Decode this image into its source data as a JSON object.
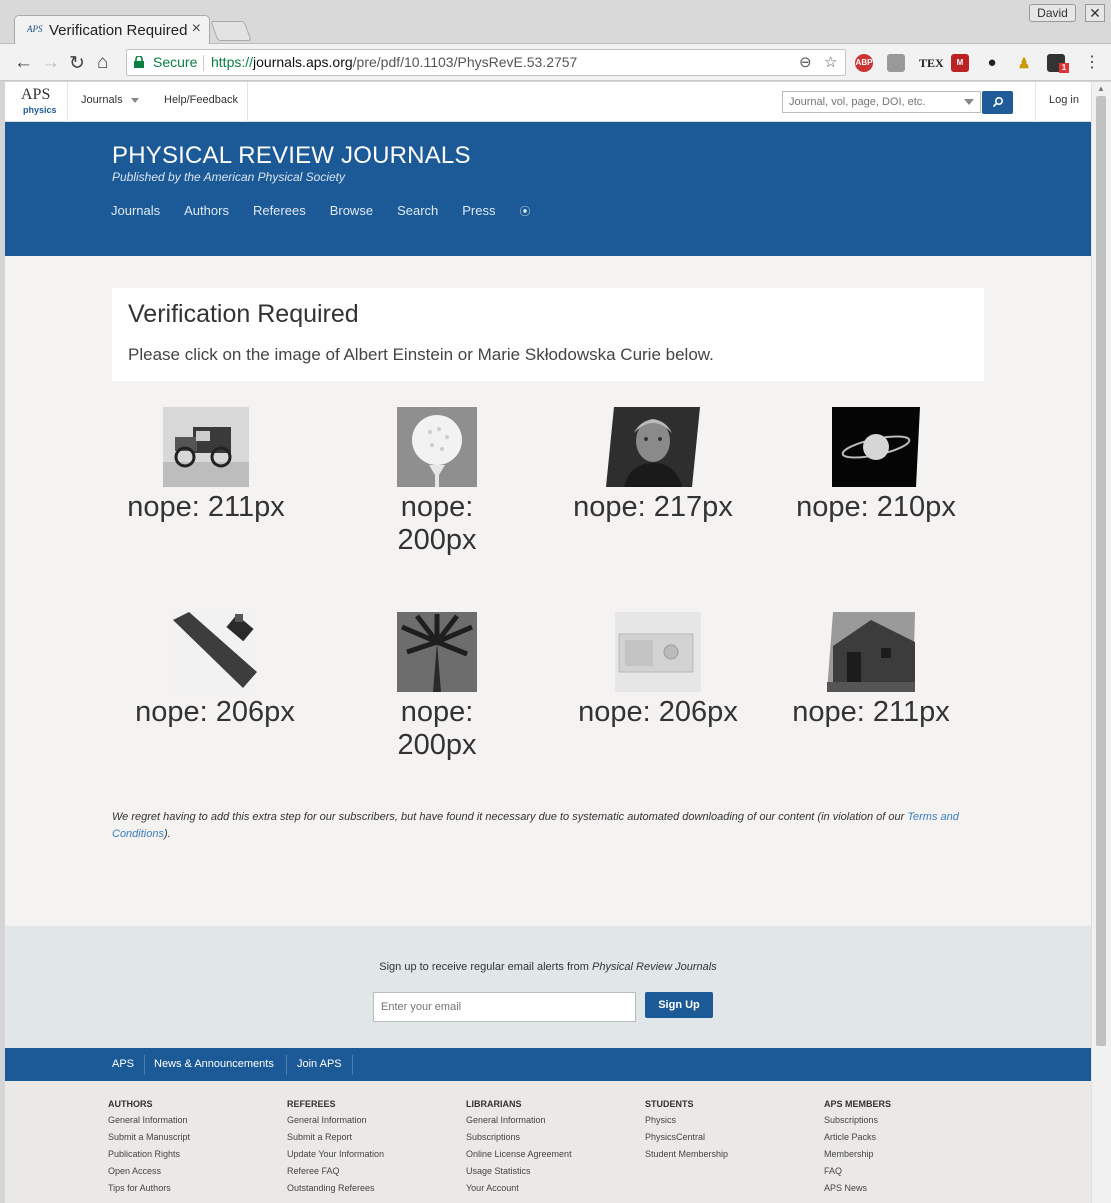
{
  "browser": {
    "tab_title": "Verification Required",
    "tab_favicon": "APS",
    "profile": "David",
    "close": "✕",
    "secure": "Secure",
    "url_scheme": "https://",
    "url_host": "journals.aps.org",
    "url_path": "/pre/pdf/10.1103/PhysRevE.53.2757",
    "ext_abp": "ABP",
    "ext_badge": "1"
  },
  "aps": {
    "logo_text": "APS",
    "logo_sub": "physics",
    "journals": "Journals",
    "help": "Help/Feedback",
    "search_placeholder": "Journal, vol, page, DOI, etc.",
    "login": "Log in"
  },
  "hero": {
    "title": "PHYSICAL REVIEW JOURNALS",
    "subtitle": "Published by the American Physical Society",
    "nav": [
      "Journals",
      "Authors",
      "Referees",
      "Browse",
      "Search",
      "Press"
    ]
  },
  "verify": {
    "title": "Verification Required",
    "instruction": "Please click on the image of Albert Einstein or Marie Skłodowska Curie below."
  },
  "captcha": [
    {
      "label": "nope: 211px",
      "subject": "vintage-car"
    },
    {
      "label": "nope: 200px",
      "subject": "golf-ball"
    },
    {
      "label": "nope: 217px",
      "subject": "marie-curie-portrait"
    },
    {
      "label": "nope: 210px",
      "subject": "saturn"
    },
    {
      "label": "nope: 206px",
      "subject": "pipe-wrench"
    },
    {
      "label": "nope: 200px",
      "subject": "palm-tree"
    },
    {
      "label": "nope: 206px",
      "subject": "vintage-radio"
    },
    {
      "label": "nope: 211px",
      "subject": "old-barn"
    }
  ],
  "notice": {
    "text": "We regret having to add this extra step for our subscribers, but have found it necessary due to systematic automated downloading of our content (in violation of our ",
    "link": "Terms and Conditions",
    "end": ")."
  },
  "signup": {
    "text": "Sign up to receive regular email alerts from ",
    "text_em": "Physical Review Journals",
    "placeholder": "Enter your email",
    "button": "Sign Up"
  },
  "footer_bar": [
    "APS",
    "News & Announcements",
    "Join APS"
  ],
  "footer_columns": [
    {
      "title": "AUTHORS",
      "items": [
        "General Information",
        "Submit a Manuscript",
        "Publication Rights",
        "Open Access",
        "Tips for Authors"
      ]
    },
    {
      "title": "REFEREES",
      "items": [
        "General Information",
        "Submit a Report",
        "Update Your Information",
        "Referee FAQ",
        "Outstanding Referees"
      ]
    },
    {
      "title": "LIBRARIANS",
      "items": [
        "General Information",
        "Subscriptions",
        "Online License Agreement",
        "Usage Statistics",
        "Your Account"
      ]
    },
    {
      "title": "STUDENTS",
      "items": [
        "Physics",
        "PhysicsCentral",
        "Student Membership"
      ]
    },
    {
      "title": "APS MEMBERS",
      "items": [
        "Subscriptions",
        "Article Packs",
        "Membership",
        "FAQ",
        "APS News"
      ]
    }
  ]
}
